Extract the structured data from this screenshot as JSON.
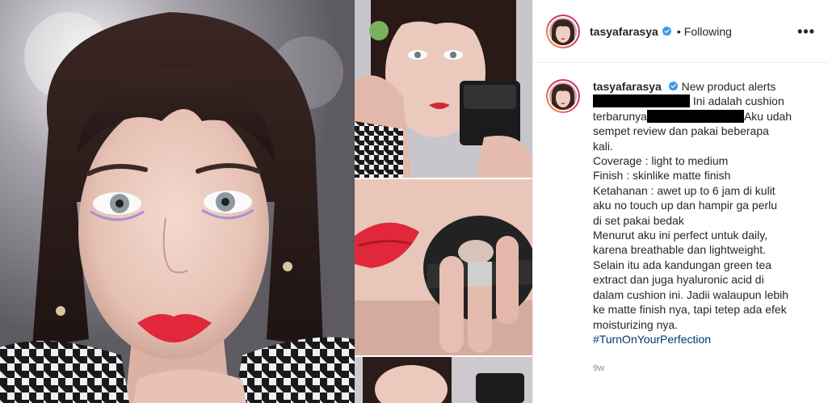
{
  "post": {
    "username": "tasyafarasya",
    "follow_status": "Following",
    "more_icon": "more-options-icon",
    "verified_icon": "verified-badge-icon"
  },
  "caption": {
    "username": "tasyafarasya",
    "lines": [
      "New product alerts",
      "Ini adalah cushion",
      "terbarunya",
      "Aku udah",
      "sempet review dan pakai beberapa",
      "kali.",
      "Coverage : light to medium",
      "Finish : skinlike matte finish",
      "Ketahanan : awet up to 6 jam di kulit",
      "aku no touch up dan hampir ga perlu",
      "di set pakai bedak",
      "Menurut aku ini perfect untuk daily,",
      "karena breathable dan lightweight.",
      "Selain itu ada kandungan green tea",
      "extract dan juga hyaluronic acid di",
      "dalam cushion ini. Jadii walaupun lebih",
      "ke matte finish nya, tapi tetep ada efek",
      "moisturizing nya."
    ],
    "hashtag": "#TurnOnYourPerfection",
    "time": "9w"
  },
  "colors": {
    "text": "#262626",
    "muted": "#8e8e8e",
    "hashtag": "#00376b",
    "verified": "#3897f0",
    "lips": "#e0283a"
  }
}
